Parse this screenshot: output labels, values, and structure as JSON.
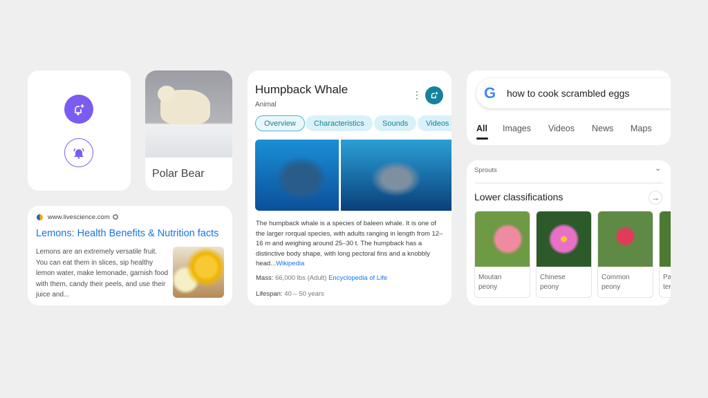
{
  "colors": {
    "background": "#efefef",
    "purple": "#7b5cf0",
    "teal": "#14829a",
    "link": "#1a73e8"
  },
  "alerts_card": {
    "icons": [
      "bell-plus-icon",
      "bell-ringing-icon"
    ]
  },
  "polar_bear_card": {
    "label": "Polar Bear"
  },
  "lemon_card": {
    "site": "www.livescience.com",
    "title": "Lemons: Health Benefits & Nutrition facts",
    "snippet": "Lemons are an extremely versatile fruit. You can eat them in slices, sip healthy lemon water, make lemonade, garnish food with them, candy their peels, and use their juice and..."
  },
  "whale_card": {
    "title": "Humpback Whale",
    "subtitle": "Animal",
    "tabs": [
      "Overview",
      "Characteristics",
      "Sounds",
      "Videos"
    ],
    "description": "The humpback whale is a species of baleen whale. It is one of the larger rorqual species, with adults ranging in length from 12–16 m and weighing around 25–30 t. The humpback has a distinctive body shape, with long pectoral fins and a knobbly head...",
    "desc_link": "Wikipedia",
    "mass_label": "Mass:",
    "mass_value": "66,000 lbs (Adult)",
    "mass_link": "Encyclopedia of Life",
    "lifespan_label": "Lifespan:",
    "lifespan_value": "40 – 50 years"
  },
  "search_card": {
    "query": "how to cook scrambled eggs",
    "tabs": [
      "All",
      "Images",
      "Videos",
      "News",
      "Maps"
    ],
    "active_tab": "All"
  },
  "classification_card": {
    "collapsed_section": "Sprouts",
    "heading": "Lower classifications",
    "items": [
      {
        "name": "Moutan\npeony"
      },
      {
        "name": "Chinese\npeony"
      },
      {
        "name": "Common\npeony"
      },
      {
        "name": "Pa\nter"
      }
    ]
  }
}
